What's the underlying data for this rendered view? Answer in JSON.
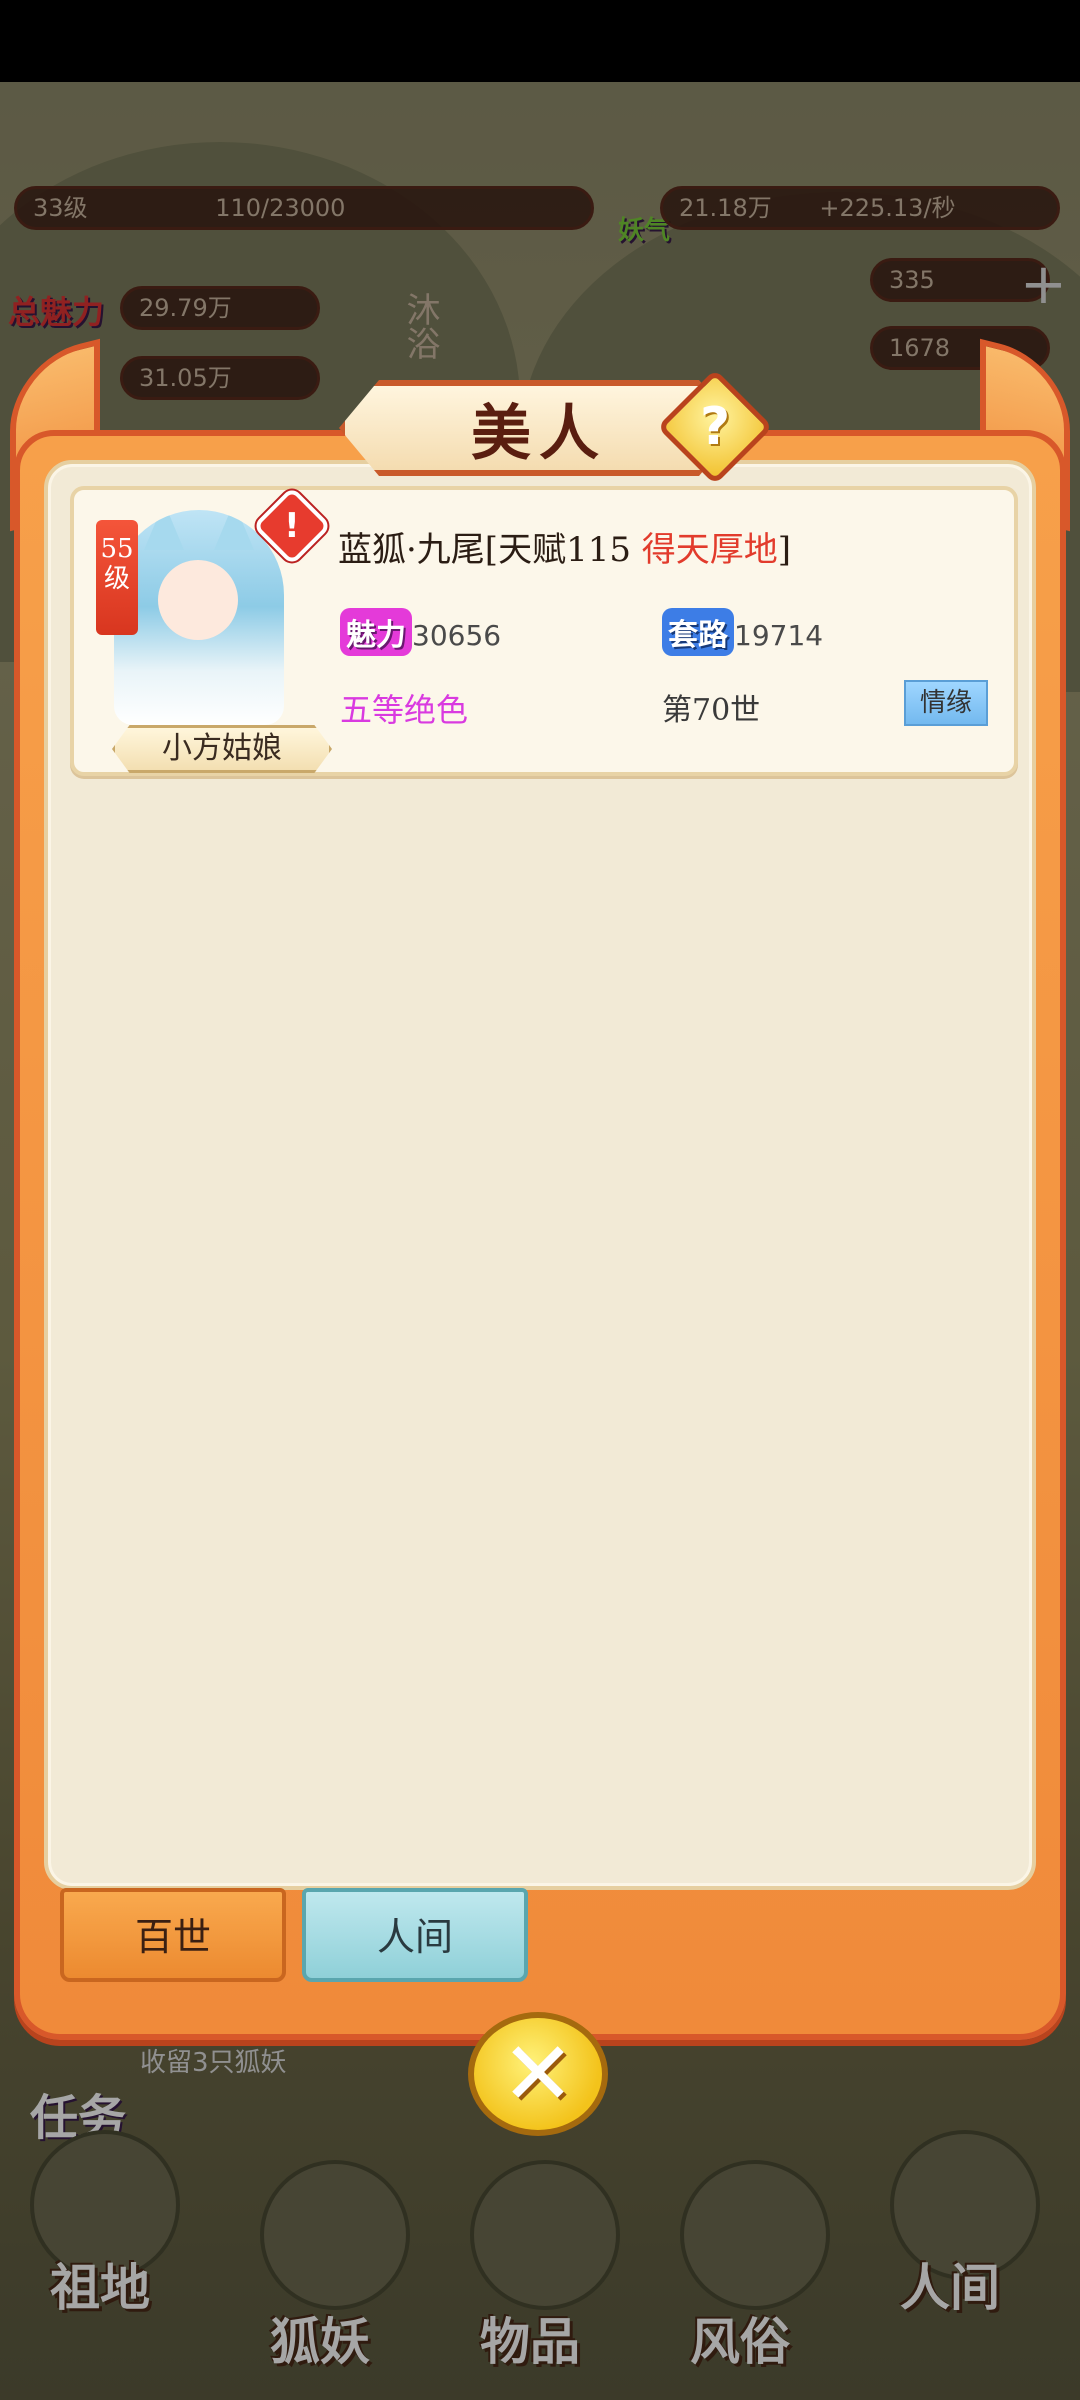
{
  "hud": {
    "level": "33级",
    "exp": "110/23000",
    "total_charm_label": "总魅力",
    "total_charm_value": "29.79万",
    "route_value": "31.05万",
    "bath_label": "沐浴",
    "fairy_qi_label": "妖气",
    "fairy_qi_value": "21.18万",
    "fairy_qi_rate": "+225.13/秒",
    "item1_value": "335",
    "item2_value": "1678",
    "quest_label": "任务",
    "quest_desc": "收留3只狐妖"
  },
  "modal": {
    "title": "美人",
    "help_icon": "question-icon",
    "close_icon": "close-icon"
  },
  "beauty": {
    "level": "55",
    "level_unit": "级",
    "name": "小方姑娘",
    "title_prefix": "蓝狐·九尾[天赋115 ",
    "talent": "得天厚地",
    "title_suffix": "]",
    "charm_label": "魅力",
    "charm_value": "30656",
    "route_label": "套路",
    "route_value": "19714",
    "grade": "五等绝色",
    "life": "第70世",
    "affinity_button": "情缘"
  },
  "tabs": [
    {
      "label": "百世",
      "active": true
    },
    {
      "label": "人间",
      "active": false
    }
  ],
  "bottom_nav": [
    "祖地",
    "狐妖",
    "物品",
    "风俗",
    "人间"
  ],
  "colors": {
    "frame": "#f08a3a",
    "panel": "#f2ead6",
    "talent": "#e23b2c",
    "grade": "#d93ae0"
  }
}
